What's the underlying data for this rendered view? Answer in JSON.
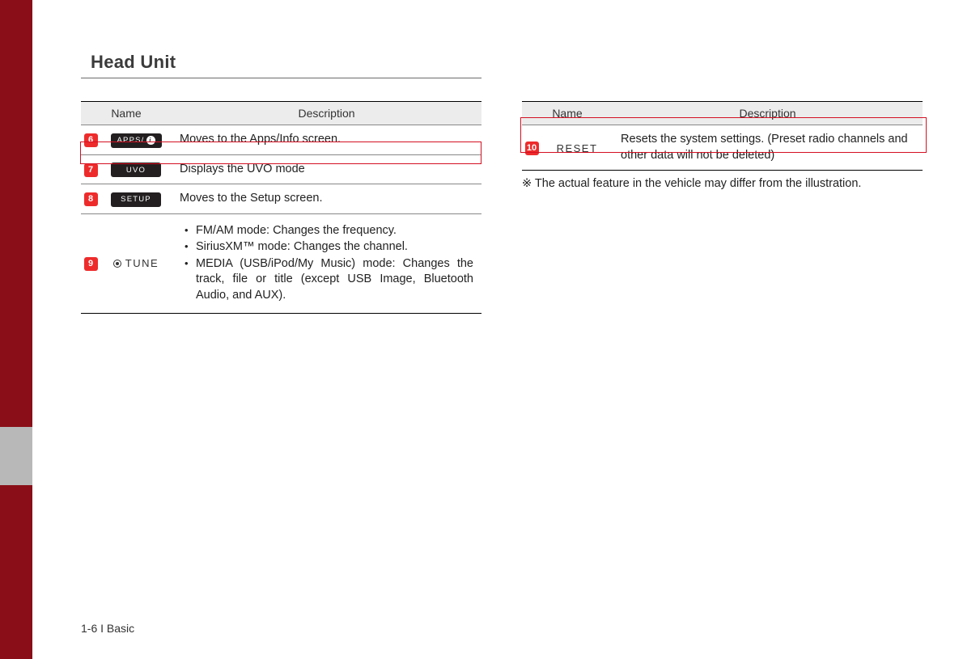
{
  "section_title": "Head Unit",
  "table_headers": {
    "name": "Name",
    "description": "Description"
  },
  "left_rows": [
    {
      "num": "6",
      "button": "APPS/",
      "has_info_icon": true,
      "desc": "Moves to the Apps/Info screen."
    },
    {
      "num": "7",
      "button": "UVO",
      "desc": "Displays the UVO mode"
    },
    {
      "num": "8",
      "button": "SETUP",
      "desc": "Moves to the Setup screen."
    },
    {
      "num": "9",
      "tune_label": "TUNE",
      "bullets": [
        "FM/AM mode: Changes the frequency.",
        "SiriusXM™ mode: Changes the channel.",
        "MEDIA (USB/iPod/My Music) mode: Changes the track, file or title (except USB Image, Bluetooth Audio, and AUX)."
      ]
    }
  ],
  "right_rows": [
    {
      "num": "10",
      "reset_label": "RESET",
      "desc": "Resets the system settings. (Preset radio channels and other data will not be deleted)"
    }
  ],
  "note": "※ The actual feature in the vehicle may differ from the illustration.",
  "footer": "1-6 I Basic"
}
